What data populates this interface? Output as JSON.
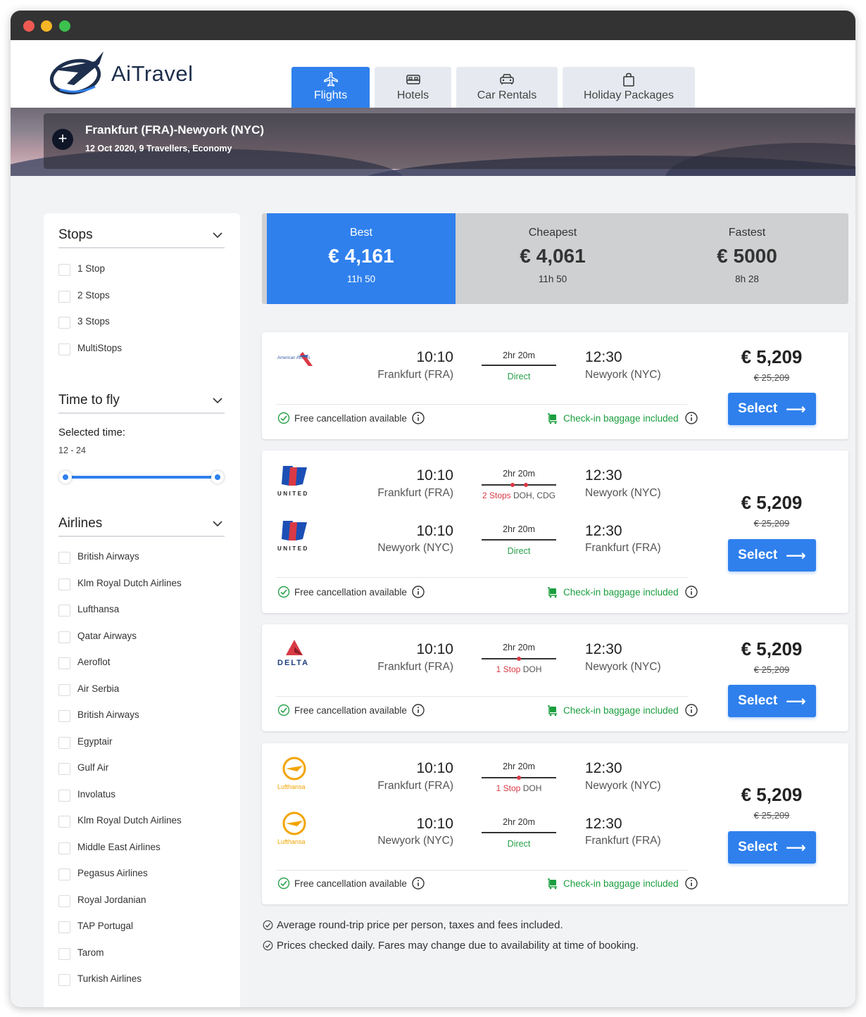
{
  "app": {
    "brand": "AiTravel"
  },
  "tabs": [
    {
      "label": "Flights",
      "icon": "plane-icon",
      "active": true
    },
    {
      "label": "Hotels",
      "icon": "bed-icon"
    },
    {
      "label": "Car Rentals",
      "icon": "car-icon"
    },
    {
      "label": "Holiday Packages",
      "icon": "shopping-bag-icon"
    }
  ],
  "search": {
    "route": "Frankfurt (FRA)-Newyork (NYC)",
    "details": "12 Oct 2020, 9 Travellers, Economy"
  },
  "filters": {
    "stops": {
      "title": "Stops",
      "options": [
        "1 Stop",
        "2 Stops",
        "3 Stops",
        "MultiStops"
      ]
    },
    "time": {
      "title": "Time to fly",
      "selected_label": "Selected time:",
      "range": "12 - 24",
      "min": 12,
      "max": 24
    },
    "airlines": {
      "title": "Airlines",
      "options": [
        "British Airways",
        "Klm Royal Dutch Airlines",
        "Lufthansa",
        "Qatar Airways",
        "Aeroflot",
        "Air Serbia",
        "British Airways",
        "Egyptair",
        "Gulf Air",
        "Involatus",
        "Klm Royal Dutch Airlines",
        "Middle East Airlines",
        "Pegasus Airlines",
        "Royal Jordanian",
        "TAP Portugal",
        "Tarom",
        "Turkish Airlines"
      ]
    }
  },
  "sort": [
    {
      "title": "Best",
      "price": "€ 4,161",
      "duration": "11h 50",
      "active": true
    },
    {
      "title": "Cheapest",
      "price": "€ 4,061",
      "duration": "11h 50"
    },
    {
      "title": "Fastest",
      "price": "€ 5000",
      "duration": "8h 28"
    }
  ],
  "results": [
    {
      "price": "€ 5,209",
      "old_price": "€ 25,209",
      "select_label": "Select",
      "free_cancel": "Free cancellation available",
      "baggage": "Check-in baggage included",
      "legs": [
        {
          "airline": "American Airlines",
          "logo_text": "American Airlines",
          "dep_time": "10:10",
          "dep_city": "Frankfurt (FRA)",
          "duration": "2hr 20m",
          "arr_time": "12:30",
          "arr_city": "Newyork (NYC)",
          "stops_label": "Direct"
        }
      ]
    },
    {
      "price": "€ 5,209",
      "old_price": "€ 25,209",
      "select_label": "Select",
      "free_cancel": "Free cancellation available",
      "baggage": "Check-in baggage included",
      "legs": [
        {
          "airline": "United",
          "logo_text": "UNITED",
          "dep_time": "10:10",
          "dep_city": "Frankfurt (FRA)",
          "duration": "2hr 20m",
          "arr_time": "12:30",
          "arr_city": "Newyork (NYC)",
          "stops_label": "2 Stops",
          "stops_via": "DOH, CDG"
        },
        {
          "airline": "United",
          "logo_text": "UNITED",
          "dep_time": "10:10",
          "dep_city": "Newyork (NYC)",
          "duration": "2hr 20m",
          "arr_time": "12:30",
          "arr_city": "Frankfurt (FRA)",
          "stops_label": "Direct"
        }
      ]
    },
    {
      "price": "€ 5,209",
      "old_price": "€ 25,209",
      "select_label": "Select",
      "free_cancel": "Free cancellation available",
      "baggage": "Check-in baggage included",
      "legs": [
        {
          "airline": "Delta",
          "logo_text": "DELTA",
          "dep_time": "10:10",
          "dep_city": "Frankfurt (FRA)",
          "duration": "2hr 20m",
          "arr_time": "12:30",
          "arr_city": "Newyork (NYC)",
          "stops_label": "1 Stop",
          "stops_via": "DOH"
        }
      ]
    },
    {
      "price": "€ 5,209",
      "old_price": "€ 25,209",
      "select_label": "Select",
      "free_cancel": "Free cancellation available",
      "baggage": "Check-in baggage included",
      "legs": [
        {
          "airline": "Lufthansa",
          "logo_text": "Lufthansa",
          "dep_time": "10:10",
          "dep_city": "Frankfurt (FRA)",
          "duration": "2hr 20m",
          "arr_time": "12:30",
          "arr_city": "Newyork (NYC)",
          "stops_label": "1 Stop",
          "stops_via": "DOH"
        },
        {
          "airline": "Lufthansa",
          "logo_text": "Lufthansa",
          "dep_time": "10:10",
          "dep_city": "Newyork (NYC)",
          "duration": "2hr 20m",
          "arr_time": "12:30",
          "arr_city": "Frankfurt (FRA)",
          "stops_label": "Direct"
        }
      ]
    }
  ],
  "notes": [
    "Average round-trip price per person, taxes and fees included.",
    "Prices checked daily. Fares may change due to availability at time of booking."
  ],
  "colors": {
    "accent": "#2f80ed",
    "stop_red": "#d93a45",
    "green": "#27a04a",
    "titlebar": "#333333"
  }
}
